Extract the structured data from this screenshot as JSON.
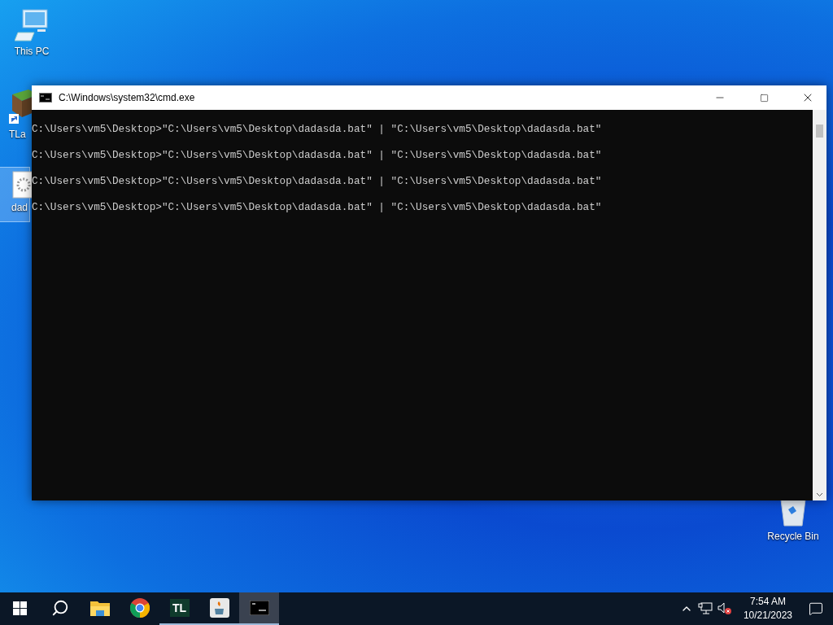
{
  "desktop_icons": [
    {
      "kind": "pc",
      "label": "This PC",
      "selected": false
    },
    {
      "kind": "grass",
      "label": "TLa",
      "selected": false
    },
    {
      "kind": "file",
      "label": "dad",
      "selected": true
    },
    {
      "kind": "bin",
      "label": "Recycle Bin",
      "selected": false
    }
  ],
  "window": {
    "title": "C:\\Windows\\system32\\cmd.exe",
    "lines": [
      "C:\\Users\\vm5\\Desktop>\"C:\\Users\\vm5\\Desktop\\dadasda.bat\" | \"C:\\Users\\vm5\\Desktop\\dadasda.bat\"",
      "C:\\Users\\vm5\\Desktop>\"C:\\Users\\vm5\\Desktop\\dadasda.bat\" | \"C:\\Users\\vm5\\Desktop\\dadasda.bat\"",
      "C:\\Users\\vm5\\Desktop>\"C:\\Users\\vm5\\Desktop\\dadasda.bat\" | \"C:\\Users\\vm5\\Desktop\\dadasda.bat\"",
      "C:\\Users\\vm5\\Desktop>\"C:\\Users\\vm5\\Desktop\\dadasda.bat\" | \"C:\\Users\\vm5\\Desktop\\dadasda.bat\""
    ]
  },
  "taskbar": {
    "apps": [
      {
        "kind": "start",
        "selected": false,
        "running": false
      },
      {
        "kind": "search",
        "selected": false,
        "running": false
      },
      {
        "kind": "folder",
        "selected": false,
        "running": false
      },
      {
        "kind": "chrome",
        "selected": false,
        "running": false
      },
      {
        "kind": "tl",
        "label": "TL",
        "selected": false,
        "running": true
      },
      {
        "kind": "java",
        "selected": false,
        "running": true
      },
      {
        "kind": "console",
        "selected": true,
        "running": true
      }
    ],
    "time": "7:54 AM",
    "date": "10/21/2023"
  }
}
